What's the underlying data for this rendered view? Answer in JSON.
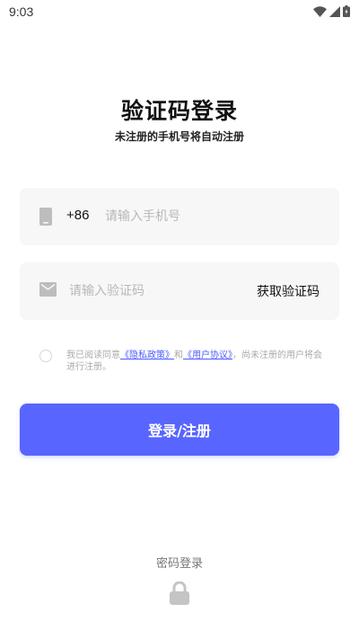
{
  "status_bar": {
    "time": "9:03",
    "icons": [
      "wifi-icon",
      "signal-icon",
      "battery-icon"
    ]
  },
  "header": {
    "title": "验证码登录",
    "subtitle": "未注册的手机号将自动注册"
  },
  "phone_field": {
    "icon": "phone-icon",
    "country_code": "+86",
    "placeholder": "请输入手机号",
    "value": ""
  },
  "code_field": {
    "icon": "mail-icon",
    "placeholder": "请输入验证码",
    "value": "",
    "get_code_label": "获取验证码"
  },
  "agreement": {
    "checked": false,
    "prefix": "我已阅读同意",
    "privacy_link": "《隐私政策》",
    "joiner": "和",
    "terms_link": "《用户协议》",
    "suffix": "，尚未注册的用户将会进行注册。"
  },
  "login_button": {
    "label": "登录/注册"
  },
  "footer": {
    "password_login_label": "密码登录",
    "lock_icon": "lock-icon"
  },
  "colors": {
    "accent": "#5865ff",
    "link": "#4b5bff",
    "field_background": "#f7f7f7",
    "placeholder": "#b8b8b8"
  }
}
